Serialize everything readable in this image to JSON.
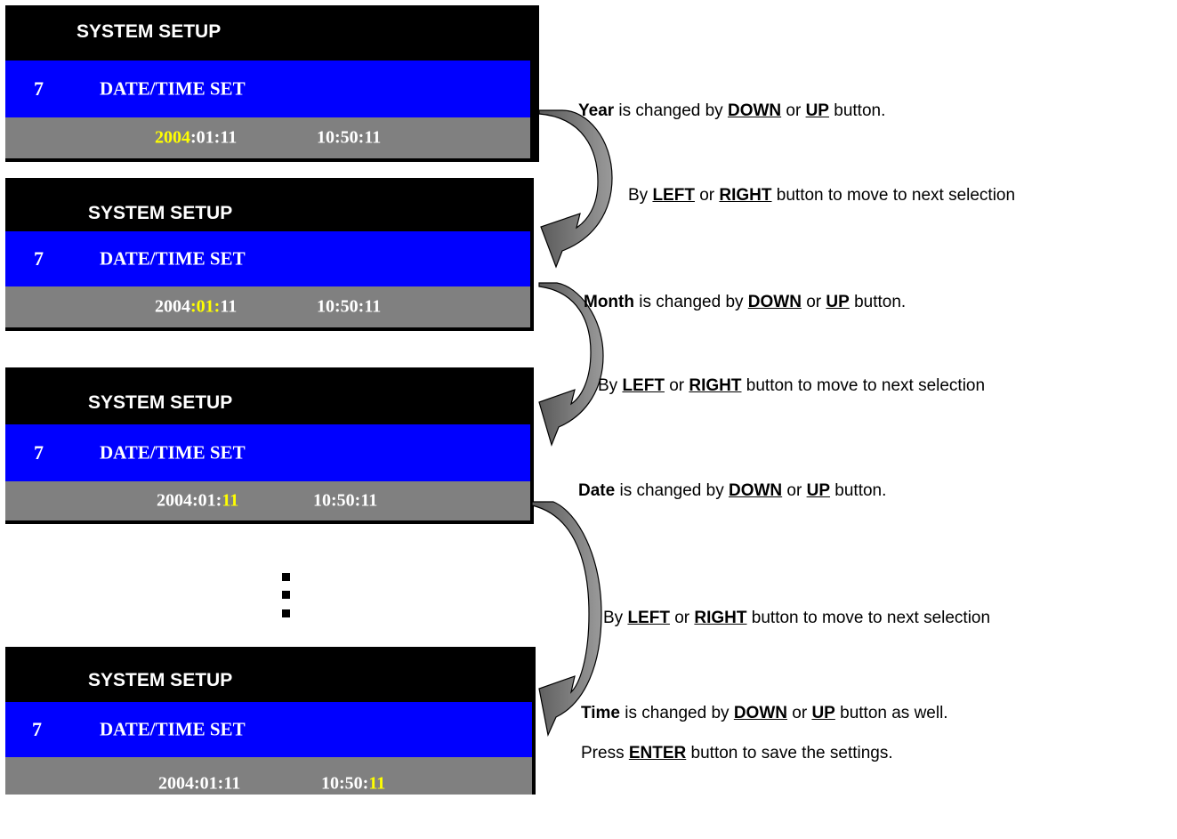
{
  "panels": [
    {
      "title": "SYSTEM SETUP",
      "menu_number": "7",
      "menu_label": "DATE/TIME SET",
      "year": "2004",
      "sep1": ":",
      "month": "01",
      "sep2": ":",
      "day": "11",
      "time_hm": "10:50:",
      "time_s": "11"
    },
    {
      "title": "SYSTEM SETUP",
      "menu_number": "7",
      "menu_label": "DATE/TIME SET",
      "year": "2004",
      "sep1": ":",
      "month": "01",
      "sep2": ":",
      "day": "11",
      "time_hm": "10:50:",
      "time_s": "11"
    },
    {
      "title": "SYSTEM SETUP",
      "menu_number": "7",
      "menu_label": "DATE/TIME SET",
      "year": "2004",
      "sep1": ":",
      "month": "01",
      "sep2": ":",
      "day": "11",
      "time_hm": "10:50:",
      "time_s": "11"
    },
    {
      "title": "SYSTEM SETUP",
      "menu_number": "7",
      "menu_label": "DATE/TIME SET",
      "year": "2004",
      "sep1": ":",
      "month": "01",
      "sep2": ":",
      "day": "11",
      "time_hm": "10:50:",
      "time_s": "11"
    }
  ],
  "highlight_color": "#ffff00",
  "notes": {
    "year": {
      "subject": "Year",
      "mid": " is changed by ",
      "b1": "DOWN",
      "or": " or ",
      "b2": "UP",
      "end": " button."
    },
    "move1": {
      "pre": "By ",
      "b1": "LEFT",
      "or": " or ",
      "b2": "RIGHT",
      "end": " button to move to next selection"
    },
    "month": {
      "subject": "Month",
      "mid": " is changed by ",
      "b1": "DOWN",
      "or": " or ",
      "b2": "UP",
      "end": " button."
    },
    "move2": {
      "pre": "By ",
      "b1": "LEFT",
      "or": " or ",
      "b2": "RIGHT",
      "end": " button to move to next selection"
    },
    "date": {
      "subject": "Date",
      "mid": " is changed by ",
      "b1": "DOWN",
      "or": " or ",
      "b2": "UP",
      "end": " button."
    },
    "move3": {
      "pre": "By ",
      "b1": "LEFT",
      "or": " or ",
      "b2": "RIGHT",
      "end": " button to move to next selection"
    },
    "time": {
      "subject": "Time",
      "mid": " is changed by ",
      "b1": "DOWN",
      "or": " or ",
      "b2": "UP",
      "end": " button as well."
    },
    "save": {
      "pre": "Press ",
      "b1": "ENTER",
      "end": " button to save the settings."
    }
  }
}
